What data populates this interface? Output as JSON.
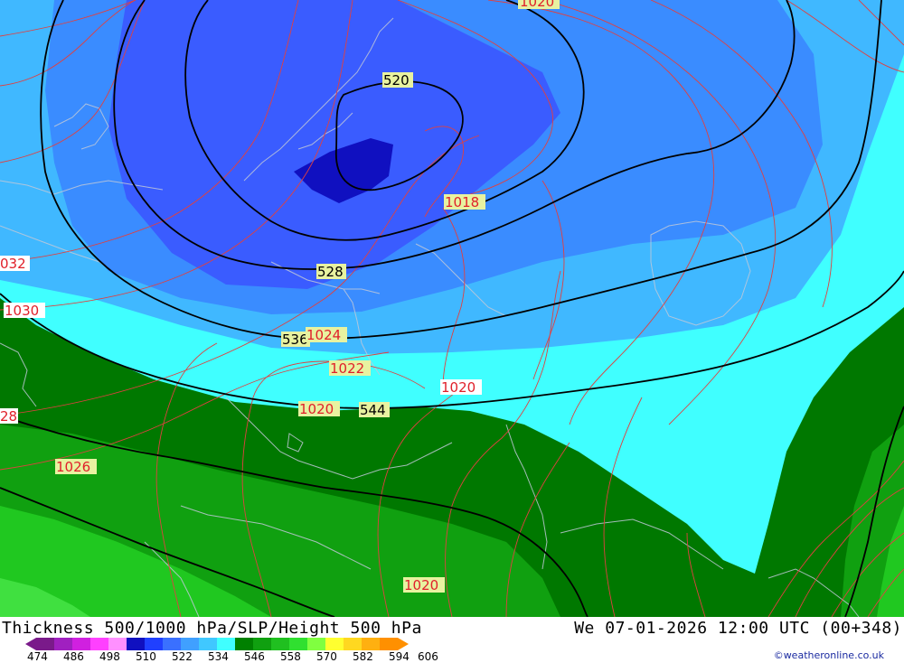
{
  "title": "Thickness 500/1000 hPa/SLP/Height 500 hPa",
  "datetime": "We 07-01-2026 12:00 UTC (00+348)",
  "credit": "©weatheronline.co.uk",
  "legend": {
    "ticks": [
      "474",
      "486",
      "498",
      "510",
      "522",
      "534",
      "546",
      "558",
      "570",
      "582",
      "594",
      "606"
    ],
    "colors": [
      "#7a1a8a",
      "#a020c0",
      "#d020e0",
      "#ff40ff",
      "#ff90ff",
      "#1010c0",
      "#2040ff",
      "#3a70ff",
      "#40a0ff",
      "#40c8ff",
      "#40ffff",
      "#008000",
      "#10a010",
      "#20c020",
      "#30e030",
      "#80ff40",
      "#ffff30",
      "#ffd820",
      "#ffb010",
      "#ff9000"
    ]
  },
  "height_labels": [
    "520",
    "528",
    "536",
    "544"
  ],
  "pressure_labels": [
    "1020",
    "1018",
    "032",
    "1030",
    "1024",
    "1022",
    "1020",
    "1020",
    "28",
    "1026",
    "1020"
  ],
  "colors": {
    "deep_blue": "#1010c0",
    "blue": "#3a5cff",
    "mid_blue": "#3a8cff",
    "light_blue": "#40b8ff",
    "cyan": "#40ffff",
    "dark_green": "#007800",
    "green": "#10a010",
    "light_green": "#20c820"
  }
}
